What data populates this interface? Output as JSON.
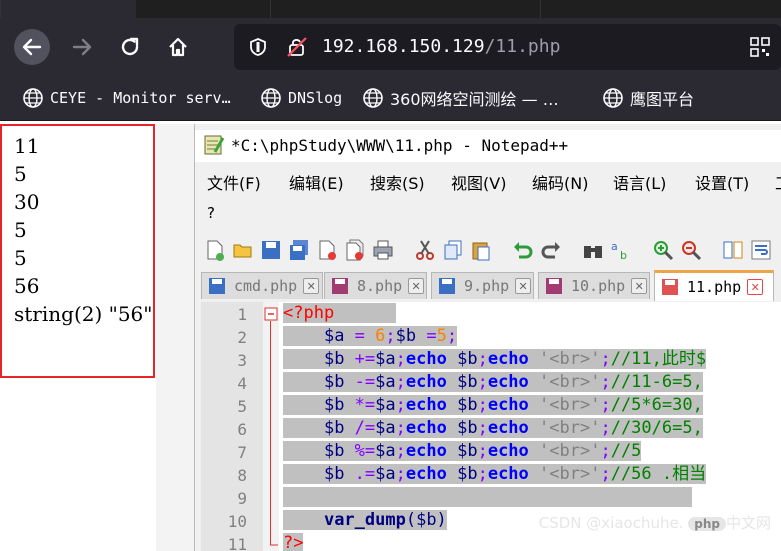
{
  "browser": {
    "url_host": "192.168.150.129",
    "url_path": "/11.php",
    "bookmarks": [
      {
        "label": "CEYE - Monitor serv…"
      },
      {
        "label": "DNSlog"
      },
      {
        "label": "360网络空间测绘 — …"
      },
      {
        "label": "鹰图平台"
      }
    ]
  },
  "output": {
    "lines": [
      "11",
      "5",
      "30",
      "5",
      "5",
      "56",
      "string(2) \"56\""
    ]
  },
  "notepad": {
    "title": "*C:\\phpStudy\\WWW\\11.php - Notepad++",
    "menu": [
      "文件(F)",
      "编辑(E)",
      "搜索(S)",
      "视图(V)",
      "编码(N)",
      "语言(L)",
      "设置(T)",
      "工"
    ],
    "help": "?",
    "tabs": [
      "cmd.php",
      "8.php",
      "9.php",
      "10.php",
      "11.php"
    ],
    "active_tab": "11.php",
    "line_numbers": [
      "1",
      "2",
      "3",
      "4",
      "5",
      "6",
      "7",
      "8",
      "9",
      "10",
      "11"
    ],
    "code": {
      "l1": "<?php",
      "l2_var1": "$a",
      "l2_eq": " = ",
      "l2_n1": "6",
      "l2_semi": ";",
      "l2_var2": "$b",
      "l2_eq2": " =",
      "l2_n2": "5",
      "l2_end": ";",
      "l3_op": " +=",
      "l3_cmt": "//11,此时$",
      "l4_op": " -=",
      "l4_cmt": "//11-6=5,",
      "l5_op": " *=",
      "l5_cmt": "//5*6=30,",
      "l6_op": " /=",
      "l6_cmt": "//30/6=5,",
      "l7_op": " %=",
      "l7_cmt": "//5",
      "l8_op": " .=",
      "l8_cmt": "//56 .相当",
      "var_a": "$a",
      "var_b": "$b",
      "echo": "echo",
      "br": "'<br>'",
      "l10_fn": "var_dump",
      "l10_arg": "($b)",
      "l11": "?>"
    }
  },
  "watermark": {
    "site": "CSDN @xiaochuhe.",
    "badge": "php",
    "suffix": "中文网"
  },
  "colors": {
    "tab_accent": "#f0a44a",
    "output_border": "#e8232a"
  }
}
